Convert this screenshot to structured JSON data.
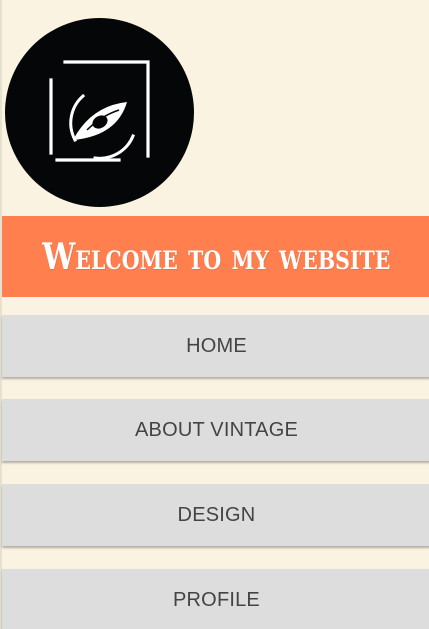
{
  "header": {
    "logo_icon": "eye-frame-logo-icon",
    "title": "Welcome to my website"
  },
  "nav": {
    "items": [
      {
        "label": "HOME"
      },
      {
        "label": "ABOUT VINTAGE"
      },
      {
        "label": "DESIGN"
      },
      {
        "label": "PROFILE"
      }
    ]
  },
  "colors": {
    "background": "#faf3e1",
    "banner": "#ff7f4f",
    "logo_circle": "#050608",
    "nav_item": "#dddddd",
    "nav_text": "#444444"
  }
}
